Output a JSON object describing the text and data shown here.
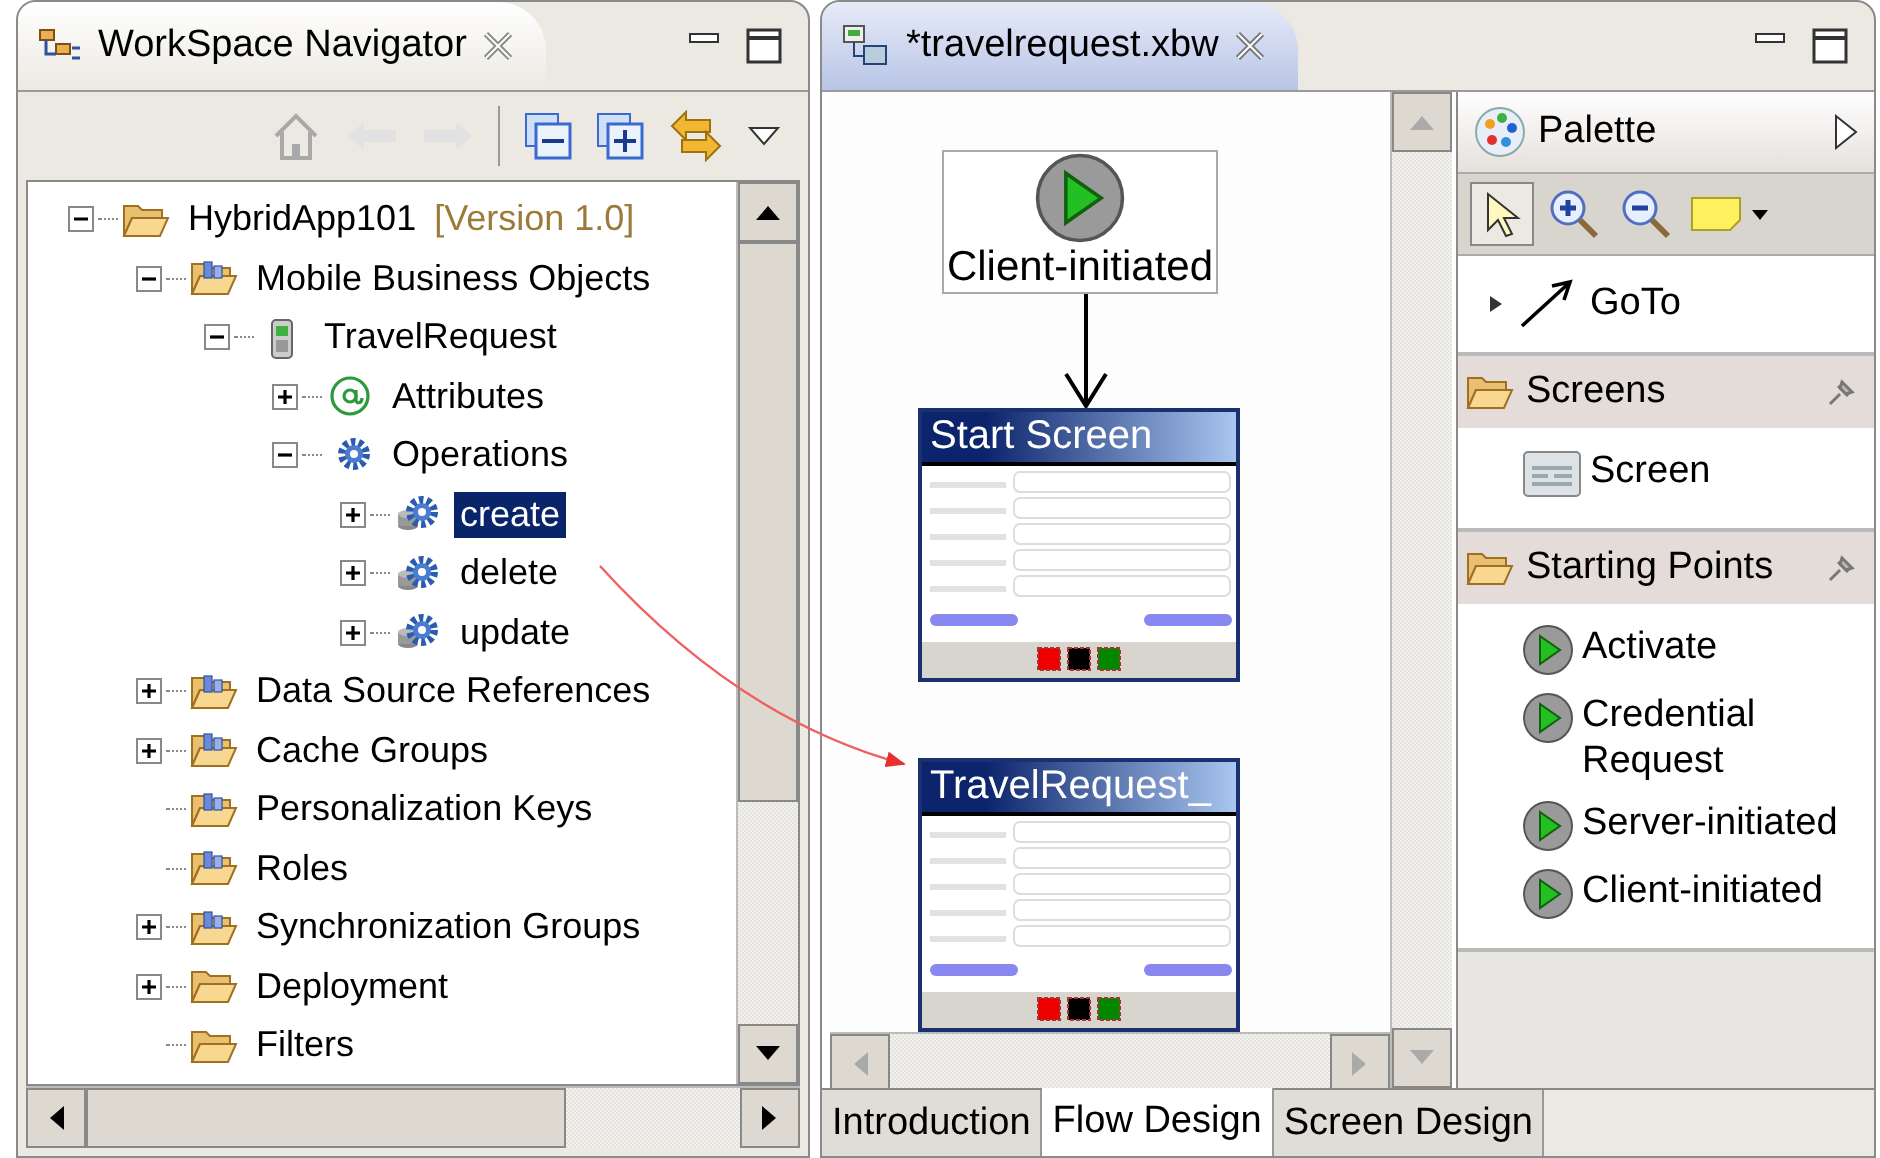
{
  "navigator": {
    "title": "WorkSpace Navigator",
    "toolbar": [
      {
        "kind": "home",
        "disabled": true
      },
      {
        "kind": "back",
        "disabled": true
      },
      {
        "kind": "forward",
        "disabled": true
      },
      {
        "kind": "collapse-all",
        "disabled": false
      },
      {
        "kind": "expand-all",
        "disabled": false
      },
      {
        "kind": "link",
        "disabled": false
      }
    ],
    "tree": [
      {
        "label": "HybridApp101",
        "version": "[Version 1.0]",
        "kind": "project",
        "expandable": true,
        "expanded": true,
        "selected": false,
        "children": [
          {
            "label": "Mobile Business Objects",
            "kind": "mbo-folder",
            "expandable": true,
            "expanded": true,
            "selected": false,
            "children": [
              {
                "label": "TravelRequest",
                "kind": "device",
                "expandable": true,
                "expanded": true,
                "selected": false,
                "children": [
                  {
                    "label": "Attributes",
                    "kind": "attributes",
                    "expandable": true,
                    "expanded": false,
                    "selected": false
                  },
                  {
                    "label": "Operations",
                    "kind": "operations",
                    "expandable": true,
                    "expanded": true,
                    "selected": false,
                    "children": [
                      {
                        "label": "create",
                        "kind": "operation",
                        "expandable": true,
                        "expanded": false,
                        "selected": true
                      },
                      {
                        "label": "delete",
                        "kind": "operation",
                        "expandable": true,
                        "expanded": false,
                        "selected": false
                      },
                      {
                        "label": "update",
                        "kind": "operation",
                        "expandable": true,
                        "expanded": false,
                        "selected": false
                      }
                    ]
                  }
                ]
              }
            ]
          },
          {
            "label": "Data Source References",
            "kind": "mbo-folder",
            "expandable": true,
            "expanded": false,
            "selected": false
          },
          {
            "label": "Cache Groups",
            "kind": "mbo-folder",
            "expandable": true,
            "expanded": false,
            "selected": false
          },
          {
            "label": "Personalization Keys",
            "kind": "mbo-folder",
            "expandable": false,
            "selected": false
          },
          {
            "label": "Roles",
            "kind": "mbo-folder",
            "expandable": false,
            "selected": false
          },
          {
            "label": "Synchronization Groups",
            "kind": "mbo-folder",
            "expandable": true,
            "expanded": false,
            "selected": false
          },
          {
            "label": "Deployment",
            "kind": "folder",
            "expandable": true,
            "expanded": false,
            "selected": false
          },
          {
            "label": "Filters",
            "kind": "folder",
            "expandable": false,
            "selected": false
          }
        ]
      }
    ]
  },
  "editor": {
    "title": "*travelrequest.xbw",
    "nodes": [
      {
        "kind": "start",
        "label": "Client-initiated"
      },
      {
        "kind": "screen",
        "label": "Start Screen"
      },
      {
        "kind": "screen",
        "label": "TravelRequest_"
      }
    ],
    "palette": {
      "title": "Palette",
      "tools": [
        {
          "kind": "select",
          "selected": true
        },
        {
          "kind": "zoom-in",
          "selected": false
        },
        {
          "kind": "zoom-out",
          "selected": false
        },
        {
          "kind": "note",
          "selected": false
        }
      ],
      "entries": [
        {
          "kind": "connection",
          "label": "GoTo"
        }
      ],
      "drawers": [
        {
          "title": "Screens",
          "items": [
            {
              "kind": "screen",
              "label": "Screen"
            }
          ]
        },
        {
          "title": "Starting Points",
          "items": [
            {
              "kind": "start",
              "label": "Activate"
            },
            {
              "kind": "start",
              "label": "Credential Request"
            },
            {
              "kind": "start",
              "label": "Server-initiated"
            },
            {
              "kind": "start",
              "label": "Client-initiated"
            }
          ]
        }
      ]
    },
    "tabs": [
      {
        "label": "Introduction",
        "selected": false
      },
      {
        "label": "Flow Design",
        "selected": true
      },
      {
        "label": "Screen Design",
        "selected": false
      }
    ]
  }
}
